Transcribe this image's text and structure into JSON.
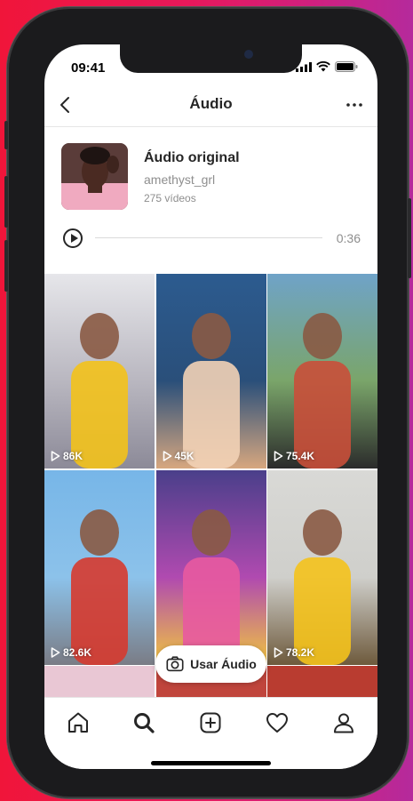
{
  "status": {
    "time": "09:41"
  },
  "header": {
    "title": "Áudio",
    "back_icon": "chevron-left-icon",
    "more_icon": "more-horizontal-icon"
  },
  "audio": {
    "name": "Áudio original",
    "user": "amethyst_grl",
    "count": "275 vídeos",
    "duration": "0:36",
    "progress": 0
  },
  "videos": [
    {
      "views": "86K",
      "colors": [
        "#e6e6ea",
        "#b9b7c0",
        "#8c8a98"
      ],
      "accent": "#f3c21b"
    },
    {
      "views": "45K",
      "colors": [
        "#2c5b8f",
        "#2a4f7a",
        "#d7a77f"
      ],
      "accent": "#f2d2b6"
    },
    {
      "views": "75.4K",
      "colors": [
        "#6fa3c8",
        "#7aa56a",
        "#2b2b2b"
      ],
      "accent": "#c94f3a"
    },
    {
      "views": "82.6K",
      "colors": [
        "#77b6e8",
        "#8cc2ea",
        "#7a7c85"
      ],
      "accent": "#d63a2f"
    },
    {
      "views": "",
      "colors": [
        "#4a3f8a",
        "#b04ab0",
        "#f1c63f"
      ],
      "accent": "#e85aa0"
    },
    {
      "views": "78.2K",
      "colors": [
        "#d9d9d6",
        "#cfcfcb",
        "#6e5a3c"
      ],
      "accent": "#f4c21c"
    }
  ],
  "use_audio_label": "Usar Áudio",
  "tabs": [
    "home-icon",
    "search-icon",
    "create-icon",
    "activity-icon",
    "profile-icon"
  ]
}
